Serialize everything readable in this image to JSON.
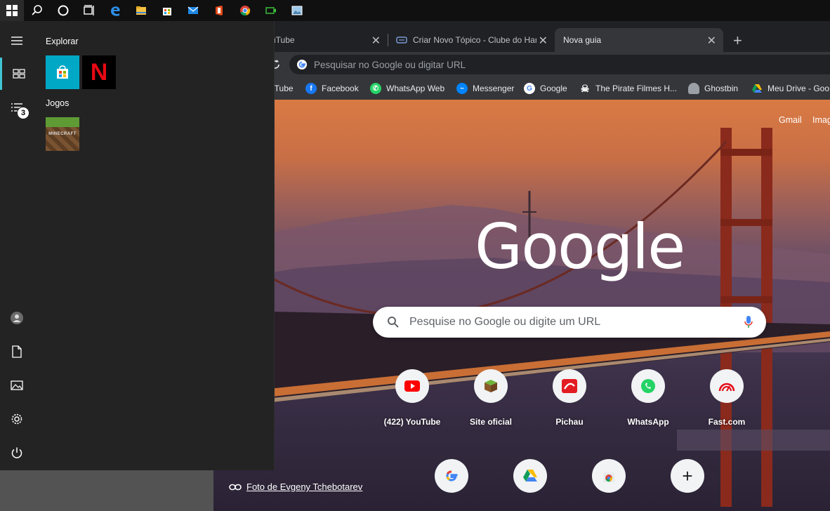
{
  "taskbar": {
    "icons": [
      "windows-start-icon",
      "search-icon",
      "cortana-icon",
      "task-view-icon",
      "edge-icon",
      "file-explorer-icon",
      "store-icon",
      "mail-icon",
      "office-icon",
      "chrome-icon",
      "xbox-icon",
      "photos-icon"
    ]
  },
  "start_menu": {
    "group_explore": "Explorar",
    "group_games": "Jogos",
    "badge_count": "3",
    "tiles": {
      "store": "Microsoft Store",
      "netflix": "N",
      "minecraft": "MINECRAFT"
    }
  },
  "chrome": {
    "tabs": [
      {
        "title": "uTube"
      },
      {
        "title": "Criar Novo Tópico - Clube do Har"
      },
      {
        "title": "Nova guia"
      }
    ],
    "omnibox_placeholder": "Pesquisar no Google ou digitar URL",
    "bookmarks": [
      {
        "label": "uTube"
      },
      {
        "label": "Facebook"
      },
      {
        "label": "WhatsApp Web"
      },
      {
        "label": "Messenger"
      },
      {
        "label": "Google"
      },
      {
        "label": "The Pirate Filmes H..."
      },
      {
        "label": "Ghostbin"
      },
      {
        "label": "Meu Drive - Goo"
      }
    ],
    "new_tab_page": {
      "link_gmail": "Gmail",
      "link_images": "Imag",
      "logo": "Google",
      "search_placeholder": "Pesquise no Google ou digite um URL",
      "shortcuts_row1": [
        {
          "label": "(422) YouTube"
        },
        {
          "label": "Site oficial"
        },
        {
          "label": "Pichau"
        },
        {
          "label": "WhatsApp"
        },
        {
          "label": "Fast.com"
        }
      ],
      "photo_credit": "Foto de Evgeny Tchebotarev"
    }
  },
  "colors": {
    "start_accent": "#41c4d4",
    "chrome_dark": "#202124",
    "chrome_toolbar": "#35363a"
  }
}
